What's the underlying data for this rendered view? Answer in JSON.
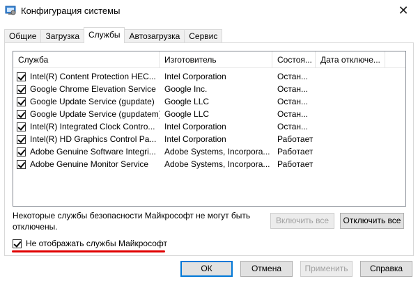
{
  "window": {
    "title": "Конфигурация системы",
    "close_glyph": "✕"
  },
  "tabs": [
    {
      "label": "Общие"
    },
    {
      "label": "Загрузка"
    },
    {
      "label": "Службы"
    },
    {
      "label": "Автозагрузка"
    },
    {
      "label": "Сервис"
    }
  ],
  "columns": [
    "Служба",
    "Изготовитель",
    "Состоя...",
    "Дата отключе..."
  ],
  "services": [
    {
      "name": "Intel(R) Content Protection HEC...",
      "vendor": "Intel Corporation",
      "status": "Остан..."
    },
    {
      "name": "Google Chrome Elevation Service",
      "vendor": "Google Inc.",
      "status": "Остан..."
    },
    {
      "name": "Google Update Service (gupdate)",
      "vendor": "Google LLC",
      "status": "Остан..."
    },
    {
      "name": "Google Update Service (gupdatem)",
      "vendor": "Google LLC",
      "status": "Остан..."
    },
    {
      "name": "Intel(R) Integrated Clock Contro...",
      "vendor": "Intel Corporation",
      "status": "Остан..."
    },
    {
      "name": "Intel(R) HD Graphics Control Pa...",
      "vendor": "Intel Corporation",
      "status": "Работает"
    },
    {
      "name": "Adobe Genuine Software Integri...",
      "vendor": "Adobe Systems, Incorpora...",
      "status": "Работает"
    },
    {
      "name": "Adobe Genuine Monitor Service",
      "vendor": "Adobe Systems, Incorpora...",
      "status": "Работает"
    }
  ],
  "note": "Некоторые службы безопасности Майкрософт не могут быть отключены.",
  "buttons": {
    "enable_all": "Включить все",
    "disable_all": "Отключить все",
    "ok": "ОК",
    "cancel": "Отмена",
    "apply": "Применить",
    "help": "Справка"
  },
  "hide_ms_label": "Не отображать службы Майкрософт",
  "colors": {
    "highlight_underline": "#e00000",
    "default_button_border": "#0078d7"
  }
}
